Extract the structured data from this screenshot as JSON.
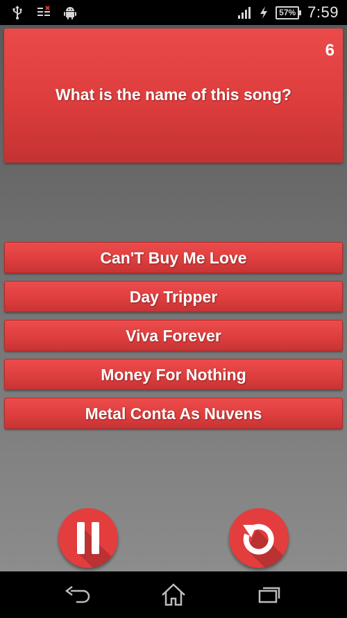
{
  "status_bar": {
    "icons": [
      "usb-icon",
      "notification-icon",
      "android-icon",
      "signal-icon",
      "charging-icon"
    ],
    "battery_level": "57%",
    "time": "7:59"
  },
  "quiz": {
    "question_number": "6",
    "question": "What is the name of this song?",
    "answers": [
      "Can'T Buy Me Love",
      "Day Tripper",
      "Viva Forever",
      "Money For Nothing",
      "Metal Conta As Nuvens"
    ]
  },
  "controls": {
    "pause_icon": "pause-icon",
    "replay_icon": "replay-icon"
  },
  "nav_bar": {
    "icons": [
      "back-icon",
      "home-icon",
      "recents-icon"
    ]
  },
  "colors": {
    "accent": "#e33d3d",
    "card": "#dd3d3d",
    "background_top": "#5a5a5a",
    "background_bottom": "#8c8c8c"
  }
}
